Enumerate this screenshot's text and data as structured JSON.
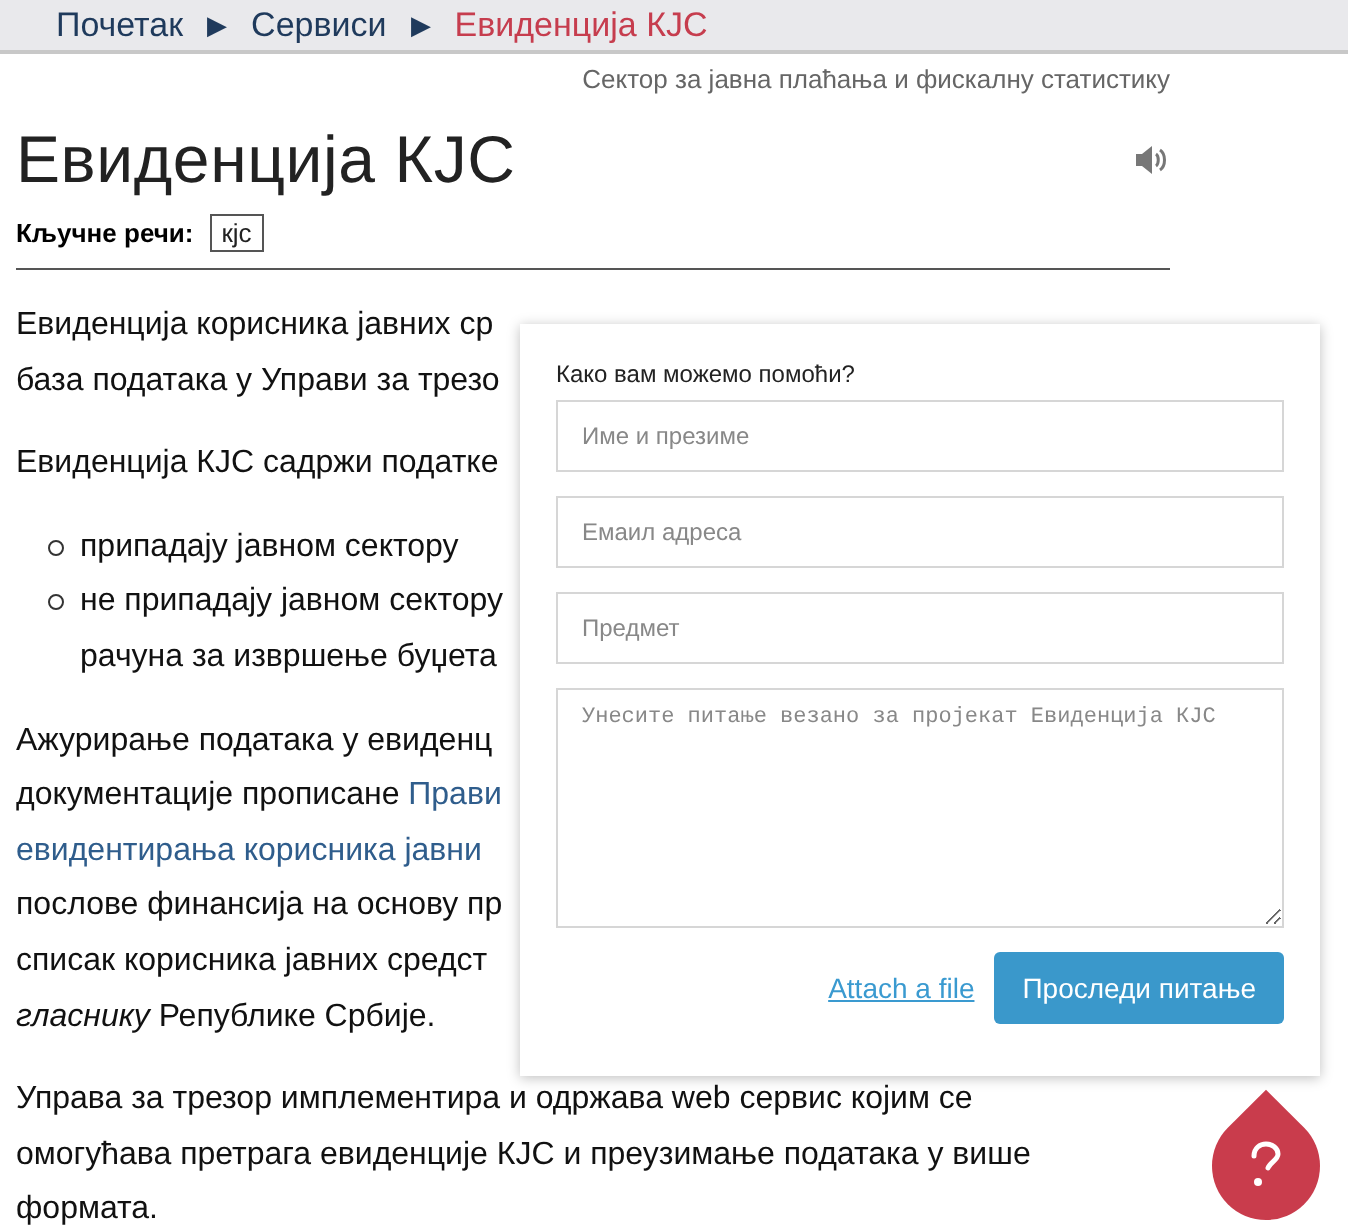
{
  "breadcrumb": [
    {
      "label": "Почетак",
      "selected": false
    },
    {
      "label": "Сервиси",
      "selected": false
    },
    {
      "label": "Евиденција КЈС",
      "selected": true
    }
  ],
  "breadcrumb_separator": "▶",
  "sector": "Сектор за јавна плаћања и фискалну статистику",
  "title": "Евиденција КЈС",
  "keywords": {
    "label": "Кључне речи:",
    "tags": [
      "кјс"
    ]
  },
  "paragraphs": [
    {
      "kind": "text",
      "lines": [
        [
          {
            "kind": "plain",
            "text": "Евиденција корисника јавних ср"
          }
        ],
        [
          {
            "kind": "plain",
            "text": "база података у Управи за трезо"
          }
        ]
      ]
    },
    {
      "kind": "text",
      "lines": [
        [
          {
            "kind": "plain",
            "text": "Евиденција КЈС садржи податке"
          }
        ]
      ]
    },
    {
      "kind": "bullets",
      "items": [
        [
          [
            {
              "kind": "plain",
              "text": "припадају јавном сектору"
            }
          ]
        ],
        [
          [
            {
              "kind": "plain",
              "text": "не припадају јавном сектору"
            }
          ],
          [
            {
              "kind": "plain",
              "text": "рачуна за извршење буџета"
            }
          ]
        ]
      ]
    },
    {
      "kind": "text",
      "lines": [
        [
          {
            "kind": "plain",
            "text": "Ажурирање података у евиденц"
          }
        ],
        [
          {
            "kind": "plain",
            "text": "документације прописане "
          },
          {
            "kind": "link",
            "text": "Прави"
          }
        ],
        [
          {
            "kind": "link",
            "text": "евидентирања корисника јавни"
          }
        ],
        [
          {
            "kind": "plain",
            "text": "послове финансија на основу пр"
          }
        ],
        [
          {
            "kind": "plain",
            "text": "списак корисника јавних средст"
          }
        ],
        [
          {
            "kind": "italic",
            "text": "гласнику"
          },
          {
            "kind": "plain",
            "text": " Републике Србије."
          }
        ]
      ]
    },
    {
      "kind": "text",
      "lines": [
        [
          {
            "kind": "plain",
            "text": "Управа за трезор имплементира и одржава web сервис којим се"
          }
        ],
        [
          {
            "kind": "plain",
            "text": "омогућава претрага евиденције КЈС и преузимање података у више"
          }
        ],
        [
          {
            "kind": "plain",
            "text": "формата."
          }
        ]
      ]
    }
  ],
  "help_form": {
    "heading": "Како вам можемо помоћи?",
    "fields": [
      {
        "placeholder": "Име и презиме"
      },
      {
        "placeholder": "Емаил адреса"
      },
      {
        "placeholder": "Предмет"
      }
    ],
    "message": {
      "placeholder": "Унесите питање везано за пројекат Евиденција КЈС"
    },
    "attach_link": "Attach a file",
    "submit": "Проследи питање"
  }
}
